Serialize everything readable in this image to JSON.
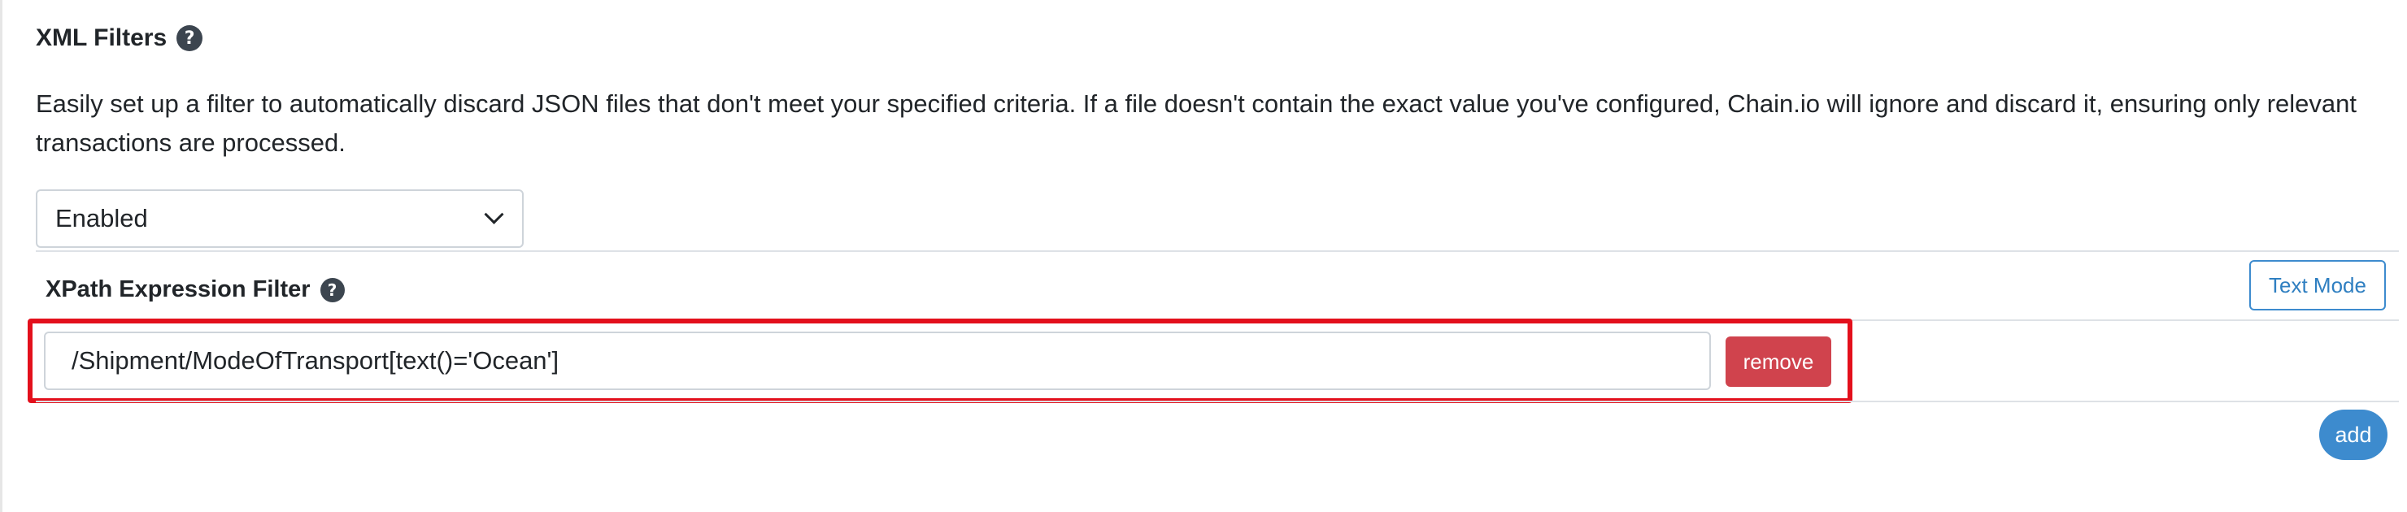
{
  "section": {
    "title": "XML Filters",
    "help_icon": "?"
  },
  "description": "Easily set up a filter to automatically discard JSON files that don't meet your specified criteria. If a file doesn't contain the exact value you've configured, Chain.io will ignore and discard it, ensuring only relevant transactions are processed.",
  "status_select": {
    "value": "Enabled"
  },
  "filter": {
    "label": "XPath Expression Filter",
    "help_icon": "?",
    "text_mode_label": "Text Mode",
    "expression": "/Shipment/ModeOfTransport[text()='Ocean']",
    "remove_label": "remove",
    "add_label": "add"
  },
  "colors": {
    "accent": "#3d8bce",
    "danger": "#d0434d",
    "highlight": "#e3101c"
  }
}
